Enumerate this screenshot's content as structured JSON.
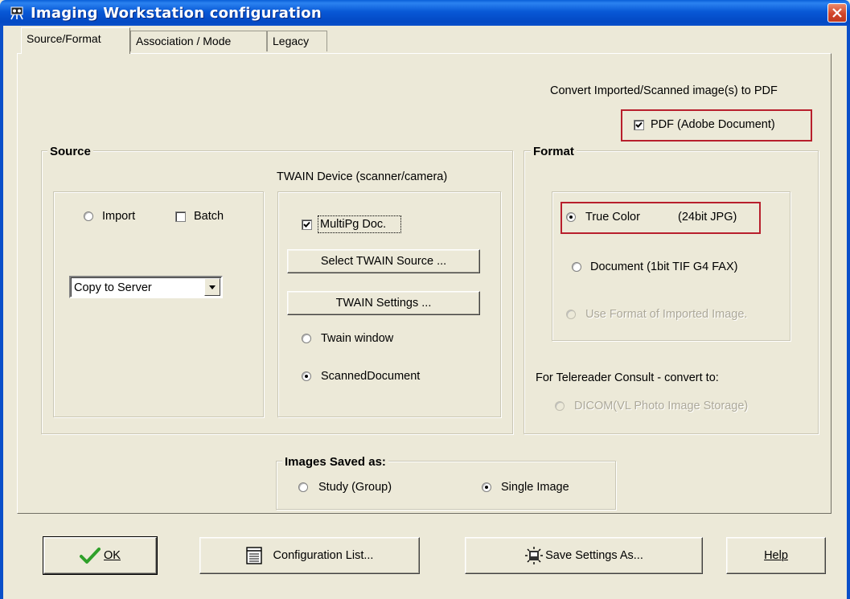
{
  "window": {
    "title": "Imaging Workstation configuration"
  },
  "tabs": [
    {
      "label": "Source/Format",
      "active": true
    },
    {
      "label": "Association / Mode",
      "active": false
    },
    {
      "label": "Legacy",
      "active": false
    }
  ],
  "pdf": {
    "caption": "Convert Imported/Scanned image(s) to PDF",
    "checkbox_label": "PDF (Adobe Document)",
    "checked": true
  },
  "source": {
    "title": "Source",
    "import_label": "Import",
    "import_selected": false,
    "batch_label": "Batch",
    "batch_checked": false,
    "dropdown_value": "Copy to Server",
    "twain_caption": "TWAIN Device (scanner/camera)",
    "multipg_label": "MultiPg Doc.",
    "multipg_checked": true,
    "select_twain_button": "Select TWAIN Source ...",
    "twain_settings_button": "TWAIN Settings ...",
    "twain_window_label": "Twain window",
    "twain_window_selected": false,
    "scanned_document_label": "ScannedDocument",
    "scanned_document_selected": true
  },
  "format": {
    "title": "Format",
    "true_color_label": "True Color",
    "true_color_detail": "(24bit JPG)",
    "true_color_selected": true,
    "document_label": "Document (1bit TIF G4 FAX)",
    "document_selected": false,
    "use_format_label": "Use Format of Imported Image.",
    "telereader_caption": "For Telereader Consult - convert to:",
    "dicom_label": "DICOM(VL Photo Image Storage)"
  },
  "saved_as": {
    "title": "Images Saved as:",
    "study_label": "Study (Group)",
    "study_selected": false,
    "single_label": "Single Image",
    "single_selected": true
  },
  "buttons": {
    "ok": "OK",
    "config_list": "Configuration List...",
    "save_settings": "Save Settings As...",
    "help": "Help"
  },
  "colors": {
    "titlebar": "#0a5fd8",
    "window_bg": "#ece9d8",
    "highlight_box": "#b81f2c",
    "ok_check": "#2fa02a"
  }
}
